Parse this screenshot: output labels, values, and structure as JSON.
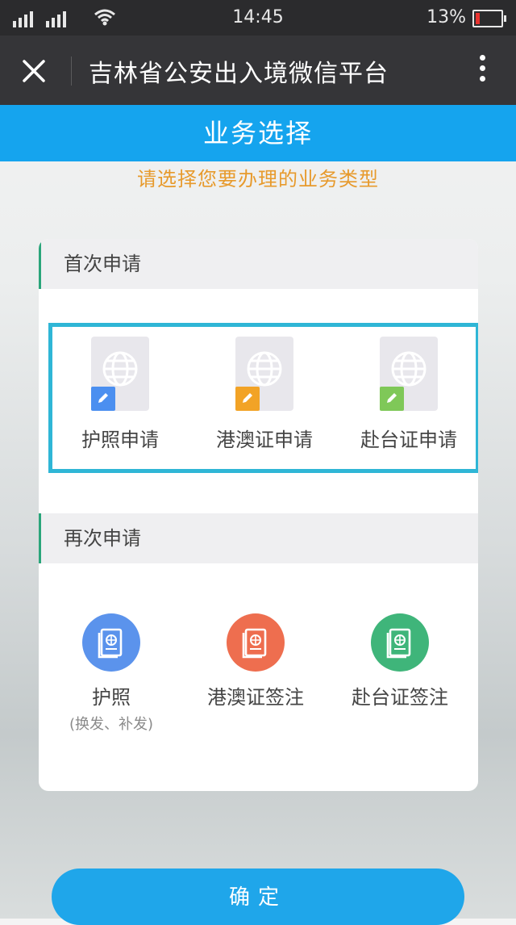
{
  "status_bar": {
    "time": "14:45",
    "battery": "13%"
  },
  "nav": {
    "title": "吉林省公安出入境微信平台"
  },
  "header": {
    "title": "业务选择",
    "subtitle": "请选择您要办理的业务类型"
  },
  "first_apply": {
    "title": "首次申请",
    "items": [
      {
        "label": "护照申请",
        "badge_color": "#4b8ff0"
      },
      {
        "label": "港澳证申请",
        "badge_color": "#f2a326"
      },
      {
        "label": "赴台证申请",
        "badge_color": "#7fc858"
      }
    ]
  },
  "reapply": {
    "title": "再次申请",
    "items": [
      {
        "label": "护照",
        "sublabel": "(换发、补发)",
        "color": "#5b93ec"
      },
      {
        "label": "港澳证签注",
        "sublabel": "",
        "color": "#ee6e4f"
      },
      {
        "label": "赴台证签注",
        "sublabel": "",
        "color": "#3fb57a"
      }
    ]
  },
  "confirm_label": "确定",
  "icons": {
    "close": "close-icon",
    "more": "more-vertical-icon",
    "passport": "passport-globe-icon",
    "edit": "pencil-icon",
    "book": "passport-book-icon"
  }
}
